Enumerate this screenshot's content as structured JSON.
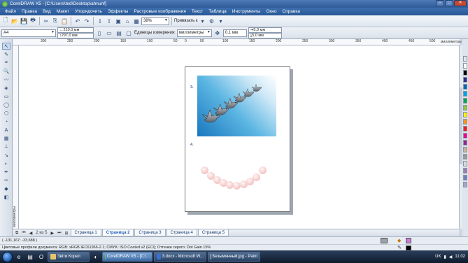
{
  "window": {
    "title": "CorelDRAW X5 - [C:\\Users\\ted\\Desktop\\ahnunf]",
    "buttons": {
      "minimize": "–",
      "maximize": "□",
      "close": "✕"
    }
  },
  "menu": [
    "Файл",
    "Правка",
    "Вид",
    "Макет",
    "Упорядочить",
    "Эффекты",
    "Растровые изображения",
    "Текст",
    "Таблица",
    "Инструменты",
    "Окно",
    "Справка"
  ],
  "toolbar": {
    "zoom": "38%",
    "snap_label": "Привязать к"
  },
  "propertybar": {
    "paper": "A4",
    "width": "210,0 мм",
    "height": "297,0 мм",
    "units_label": "Единицы измерения:",
    "units": "миллиметры",
    "nudge": "0,1 мм",
    "dup_x": "5,0 мм",
    "dup_y": "5,0 мм"
  },
  "ruler": {
    "h_ticks": [
      "300",
      "250",
      "200",
      "150",
      "100",
      "50",
      "0",
      "50",
      "100",
      "150",
      "200",
      "250",
      "300",
      "350",
      "400",
      "450",
      "500",
      "миллиметры"
    ],
    "v_label": "миллиметры"
  },
  "canvas": {
    "label3": "3.",
    "label4": "4."
  },
  "pages": {
    "counter": "2 из 5",
    "tabs": [
      "Страница 1",
      "Страница 2",
      "Страница 3",
      "Страница 4",
      "Страница 5"
    ],
    "active": 1
  },
  "status": {
    "coords": "( -131,167; -33,688 )",
    "profiles": "Цветовые профили документа: RGB: sRGB IEC61966-2.1; CMYK: ISO Coated v2 (ECI); Оттенки серого: Dot Gain 15%"
  },
  "taskbar": {
    "tasks": [
      "Звіти Корел",
      "CorelDRAW X5 - [C:\\...",
      "3.docx - Microsoft W...",
      "Безымянный.jpg - Paint"
    ],
    "active": 1,
    "lang": "UK",
    "clock": "11:02"
  },
  "colors": {
    "accent": "#2f5a97",
    "palette": [
      "#ffffff",
      "#000000",
      "#2b2e83",
      "#0066b3",
      "#00a3e0",
      "#00a651",
      "#8dc63f",
      "#fff200",
      "#f7941d",
      "#ed1c24",
      "#ec008c",
      "#92278f",
      "#c7b299",
      "#999999",
      "#d9d9d9",
      "#9b7bb5",
      "#6f7fbf",
      "#a6a6c9"
    ]
  }
}
